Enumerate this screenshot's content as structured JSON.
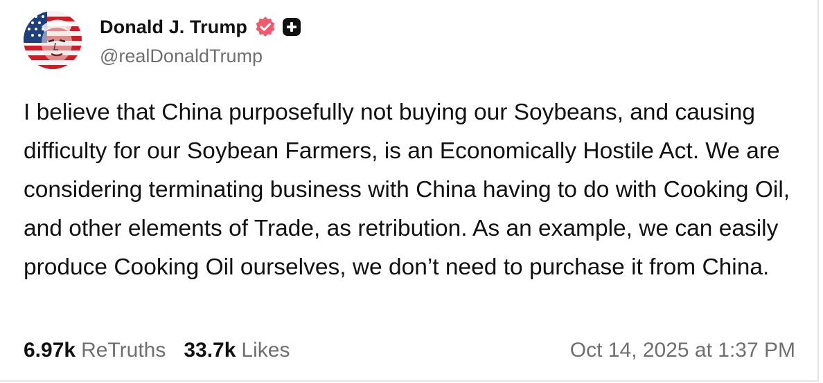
{
  "author": {
    "display_name": "Donald J. Trump",
    "handle": "@realDonaldTrump",
    "avatar_icon": "flag-portrait-avatar",
    "verified_icon": "verified-badge-icon",
    "extra_badge_icon": "plus-badge-icon"
  },
  "post": {
    "text": "I believe that China purposefully not buying our Soybeans, and causing difficulty for our Soybean Farmers, is an Economically Hostile Act. We are considering terminating business with China having to do with Cooking Oil, and other elements of Trade, as retribution. As an example, we can easily produce Cooking Oil ourselves, we don’t need to purchase it from China."
  },
  "stats": {
    "retruths_count": "6.97k",
    "retruths_label": "ReTruths",
    "likes_count": "33.7k",
    "likes_label": "Likes"
  },
  "timestamp": "Oct 14, 2025 at 1:37 PM",
  "colors": {
    "text_primary": "#111111",
    "text_secondary": "#6f6f6f",
    "verified_badge": "#ef5a6f",
    "plus_badge": "#111111"
  }
}
